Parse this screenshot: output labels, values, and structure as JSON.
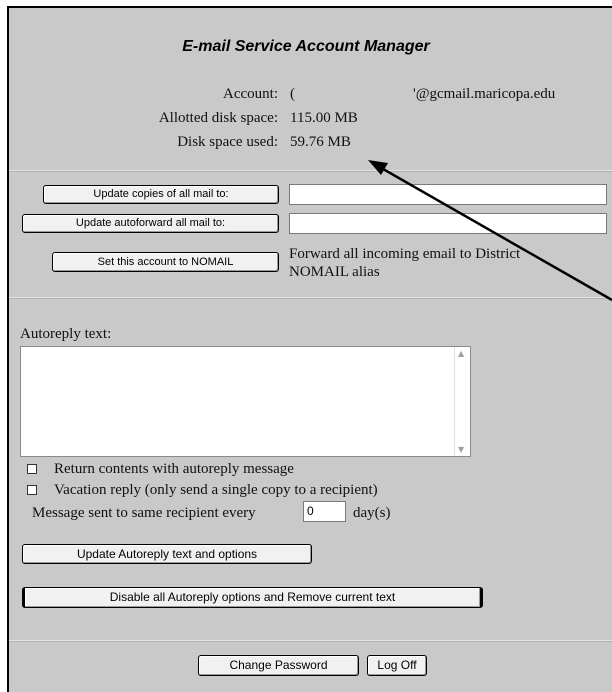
{
  "header": {
    "title": "E-mail Service Account Manager"
  },
  "account": {
    "account_label": "Account:",
    "account_prefix": "(",
    "account_domain": "'@gcmail.maricopa.edu",
    "allotted_label": "Allotted disk space:",
    "allotted_value": "115.00 MB",
    "used_label": "Disk space used:",
    "used_value": "59.76 MB"
  },
  "forwarding": {
    "copies_button": "Update copies of all mail to:",
    "copies_value": "",
    "autoforward_button": "Update autoforward all mail to:",
    "autoforward_value": "",
    "nomail_button": "Set this account to NOMAIL",
    "nomail_note_line1": "Forward all incoming email to District",
    "nomail_note_line2": "NOMAIL alias"
  },
  "autoreply": {
    "label": "Autoreply text:",
    "text": "",
    "return_contents_label": "Return contents with autoreply message",
    "vacation_label": "Vacation reply (only send a single copy to a recipient)",
    "interval_prefix": "Message sent to same recipient every",
    "interval_value": "0",
    "interval_suffix": "day(s)",
    "update_button": "Update Autoreply text and options",
    "disable_button": "Disable all Autoreply options and Remove current text"
  },
  "footer": {
    "change_password_button": "Change Password",
    "logoff_button": "Log Off"
  },
  "colors": {
    "panel_bg": "#c9c9c9",
    "arrow": "#000000"
  }
}
